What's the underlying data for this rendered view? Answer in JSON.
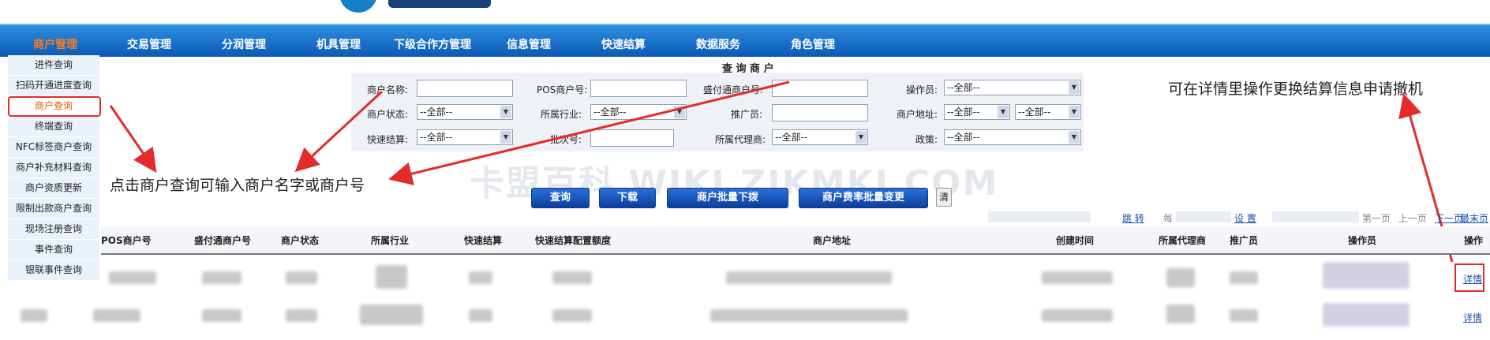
{
  "nav": {
    "items": [
      "商户管理",
      "交易管理",
      "分润管理",
      "机具管理",
      "下级合作方管理",
      "信息管理",
      "快速结算",
      "数据服务",
      "角色管理"
    ],
    "active": "商户管理"
  },
  "sidebar": {
    "items": [
      "进件查询",
      "扫码开通进度查询",
      "商户查询",
      "终端查询",
      "NFC标签商户查询",
      "商户补充材料查询",
      "商户资质更新",
      "限制出款商户查询",
      "现场注册查询",
      "事件查询",
      "银联事件查询"
    ],
    "active": "商户查询"
  },
  "panel": {
    "title": "查 询 商 户"
  },
  "form": {
    "labels": {
      "merchant_name": "商户名称:",
      "pos_no": "POS商户号:",
      "sft_no": "盛付通商户号:",
      "operator": "操作员:",
      "status": "商户状态:",
      "industry": "所属行业:",
      "promoter": "推广员:",
      "address": "商户地址:",
      "quick_settle": "快速结算:",
      "batch_no": "批次号:",
      "agent": "所属代理商:",
      "policy": "政策:"
    },
    "select_default": "--全部--"
  },
  "buttons": {
    "query": "查询",
    "download": "下载",
    "batch_issue": "商户批量下拨",
    "batch_rate": "商户费率批量变更",
    "clear": "清"
  },
  "pager": {
    "jump": "跳 转",
    "per_page_prefix": "每",
    "settings": "设 置",
    "first": "第一页",
    "prev": "上一页",
    "next": "下一页",
    "last": "最末页"
  },
  "table": {
    "headers": [
      "POS商户号",
      "盛付通商户号",
      "商户状态",
      "所属行业",
      "快速结算",
      "快速结算配置额度",
      "商户地址",
      "创建时间",
      "所属代理商",
      "推广员",
      "操作员",
      "操作"
    ],
    "row_action": "详情"
  },
  "annotations": {
    "left": "点击商户查询可输入商户名字或商户号",
    "right": "可在详情里操作更换结算信息申请撤机"
  },
  "watermark": "卡盟百科 WIKI.ZJKMKJ.COM",
  "colors": {
    "nav_bg": "#0b59b6",
    "active_nav": "#ff7b1c",
    "annotation_red": "#e32b2b",
    "link": "#1a4fa8"
  }
}
